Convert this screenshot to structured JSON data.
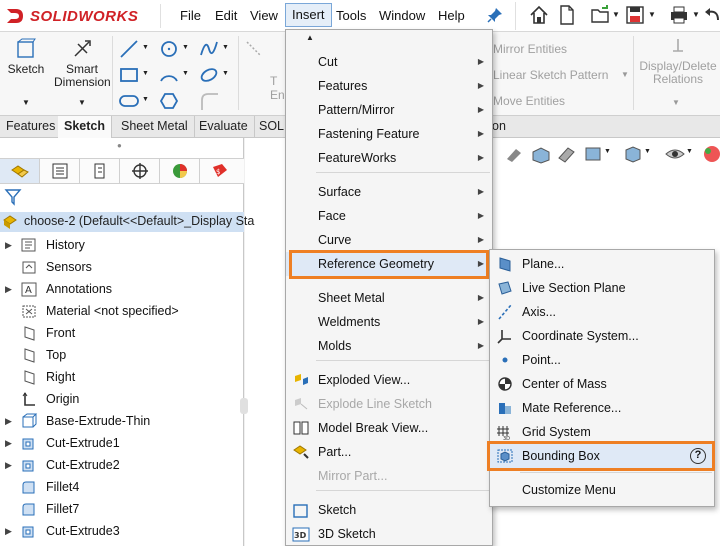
{
  "app": {
    "logo_text": "SOLIDWORKS"
  },
  "menubar": [
    "File",
    "Edit",
    "View",
    "Insert",
    "Tools",
    "Window",
    "Help"
  ],
  "toolbar": {
    "sketch_label": "Sketch",
    "smart_dimension_label": "Smart Dimension",
    "mirror_entities": "Mirror Entities",
    "linear_sketch_pattern": "Linear Sketch Pattern",
    "move_entities": "Move Entities",
    "display_delete_relations": "Display/Delete Relations",
    "trim_fragment": "T",
    "entities_fragment": "En"
  },
  "tabs": [
    "Features",
    "Sketch",
    "Sheet Metal",
    "Evaluate",
    "SOLI",
    "on"
  ],
  "feature_tree": {
    "root": "choose-2  (Default<<Default>_Display Sta",
    "items": [
      {
        "label": "History",
        "expandable": true,
        "icon": "history-icon"
      },
      {
        "label": "Sensors",
        "expandable": false,
        "icon": "sensors-icon"
      },
      {
        "label": "Annotations",
        "expandable": true,
        "icon": "annotations-icon"
      },
      {
        "label": "Material <not specified>",
        "expandable": false,
        "icon": "material-icon"
      },
      {
        "label": "Front",
        "expandable": false,
        "icon": "plane-icon"
      },
      {
        "label": "Top",
        "expandable": false,
        "icon": "plane-icon"
      },
      {
        "label": "Right",
        "expandable": false,
        "icon": "plane-icon"
      },
      {
        "label": "Origin",
        "expandable": false,
        "icon": "origin-icon"
      },
      {
        "label": "Base-Extrude-Thin",
        "expandable": true,
        "icon": "extrude-icon"
      },
      {
        "label": "Cut-Extrude1",
        "expandable": true,
        "icon": "cut-extrude-icon"
      },
      {
        "label": "Cut-Extrude2",
        "expandable": true,
        "icon": "cut-extrude-icon"
      },
      {
        "label": "Fillet4",
        "expandable": false,
        "icon": "fillet-icon"
      },
      {
        "label": "Fillet7",
        "expandable": false,
        "icon": "fillet-icon"
      },
      {
        "label": "Cut-Extrude3",
        "expandable": true,
        "icon": "cut-extrude-icon"
      }
    ]
  },
  "insert_menu": {
    "items": [
      {
        "label": "Cut",
        "submenu": true
      },
      {
        "label": "Features",
        "submenu": true
      },
      {
        "label": "Pattern/Mirror",
        "submenu": true
      },
      {
        "label": "Fastening Feature",
        "submenu": true
      },
      {
        "label": "FeatureWorks",
        "submenu": true
      },
      {
        "label": "Surface",
        "submenu": true
      },
      {
        "label": "Face",
        "submenu": true
      },
      {
        "label": "Curve",
        "submenu": true
      },
      {
        "label": "Reference Geometry",
        "submenu": true
      },
      {
        "label": "Sheet Metal",
        "submenu": true
      },
      {
        "label": "Weldments",
        "submenu": true
      },
      {
        "label": "Molds",
        "submenu": true
      },
      {
        "label": "Exploded View...",
        "submenu": false
      },
      {
        "label": "Explode Line Sketch",
        "submenu": false,
        "disabled": true
      },
      {
        "label": "Model Break View...",
        "submenu": false
      },
      {
        "label": "Part...",
        "submenu": false
      },
      {
        "label": "Mirror Part...",
        "submenu": false,
        "disabled": true
      },
      {
        "label": "Sketch",
        "submenu": false
      },
      {
        "label": "3D Sketch",
        "submenu": false
      }
    ]
  },
  "reference_geometry_menu": {
    "items": [
      {
        "label": "Plane...",
        "icon": "plane-icon"
      },
      {
        "label": "Live Section Plane",
        "icon": "live-section-plane-icon"
      },
      {
        "label": "Axis...",
        "icon": "axis-icon"
      },
      {
        "label": "Coordinate System...",
        "icon": "coordinate-system-icon"
      },
      {
        "label": "Point...",
        "icon": "point-icon"
      },
      {
        "label": "Center of Mass",
        "icon": "center-of-mass-icon"
      },
      {
        "label": "Mate Reference...",
        "icon": "mate-reference-icon"
      },
      {
        "label": "Grid System",
        "icon": "grid-system-icon"
      },
      {
        "label": "Bounding Box",
        "icon": "bounding-box-icon"
      },
      {
        "label": "Customize Menu",
        "icon": ""
      }
    ]
  },
  "colors": {
    "highlight_outline": "#ee7f24",
    "brand_red": "#d02126"
  }
}
